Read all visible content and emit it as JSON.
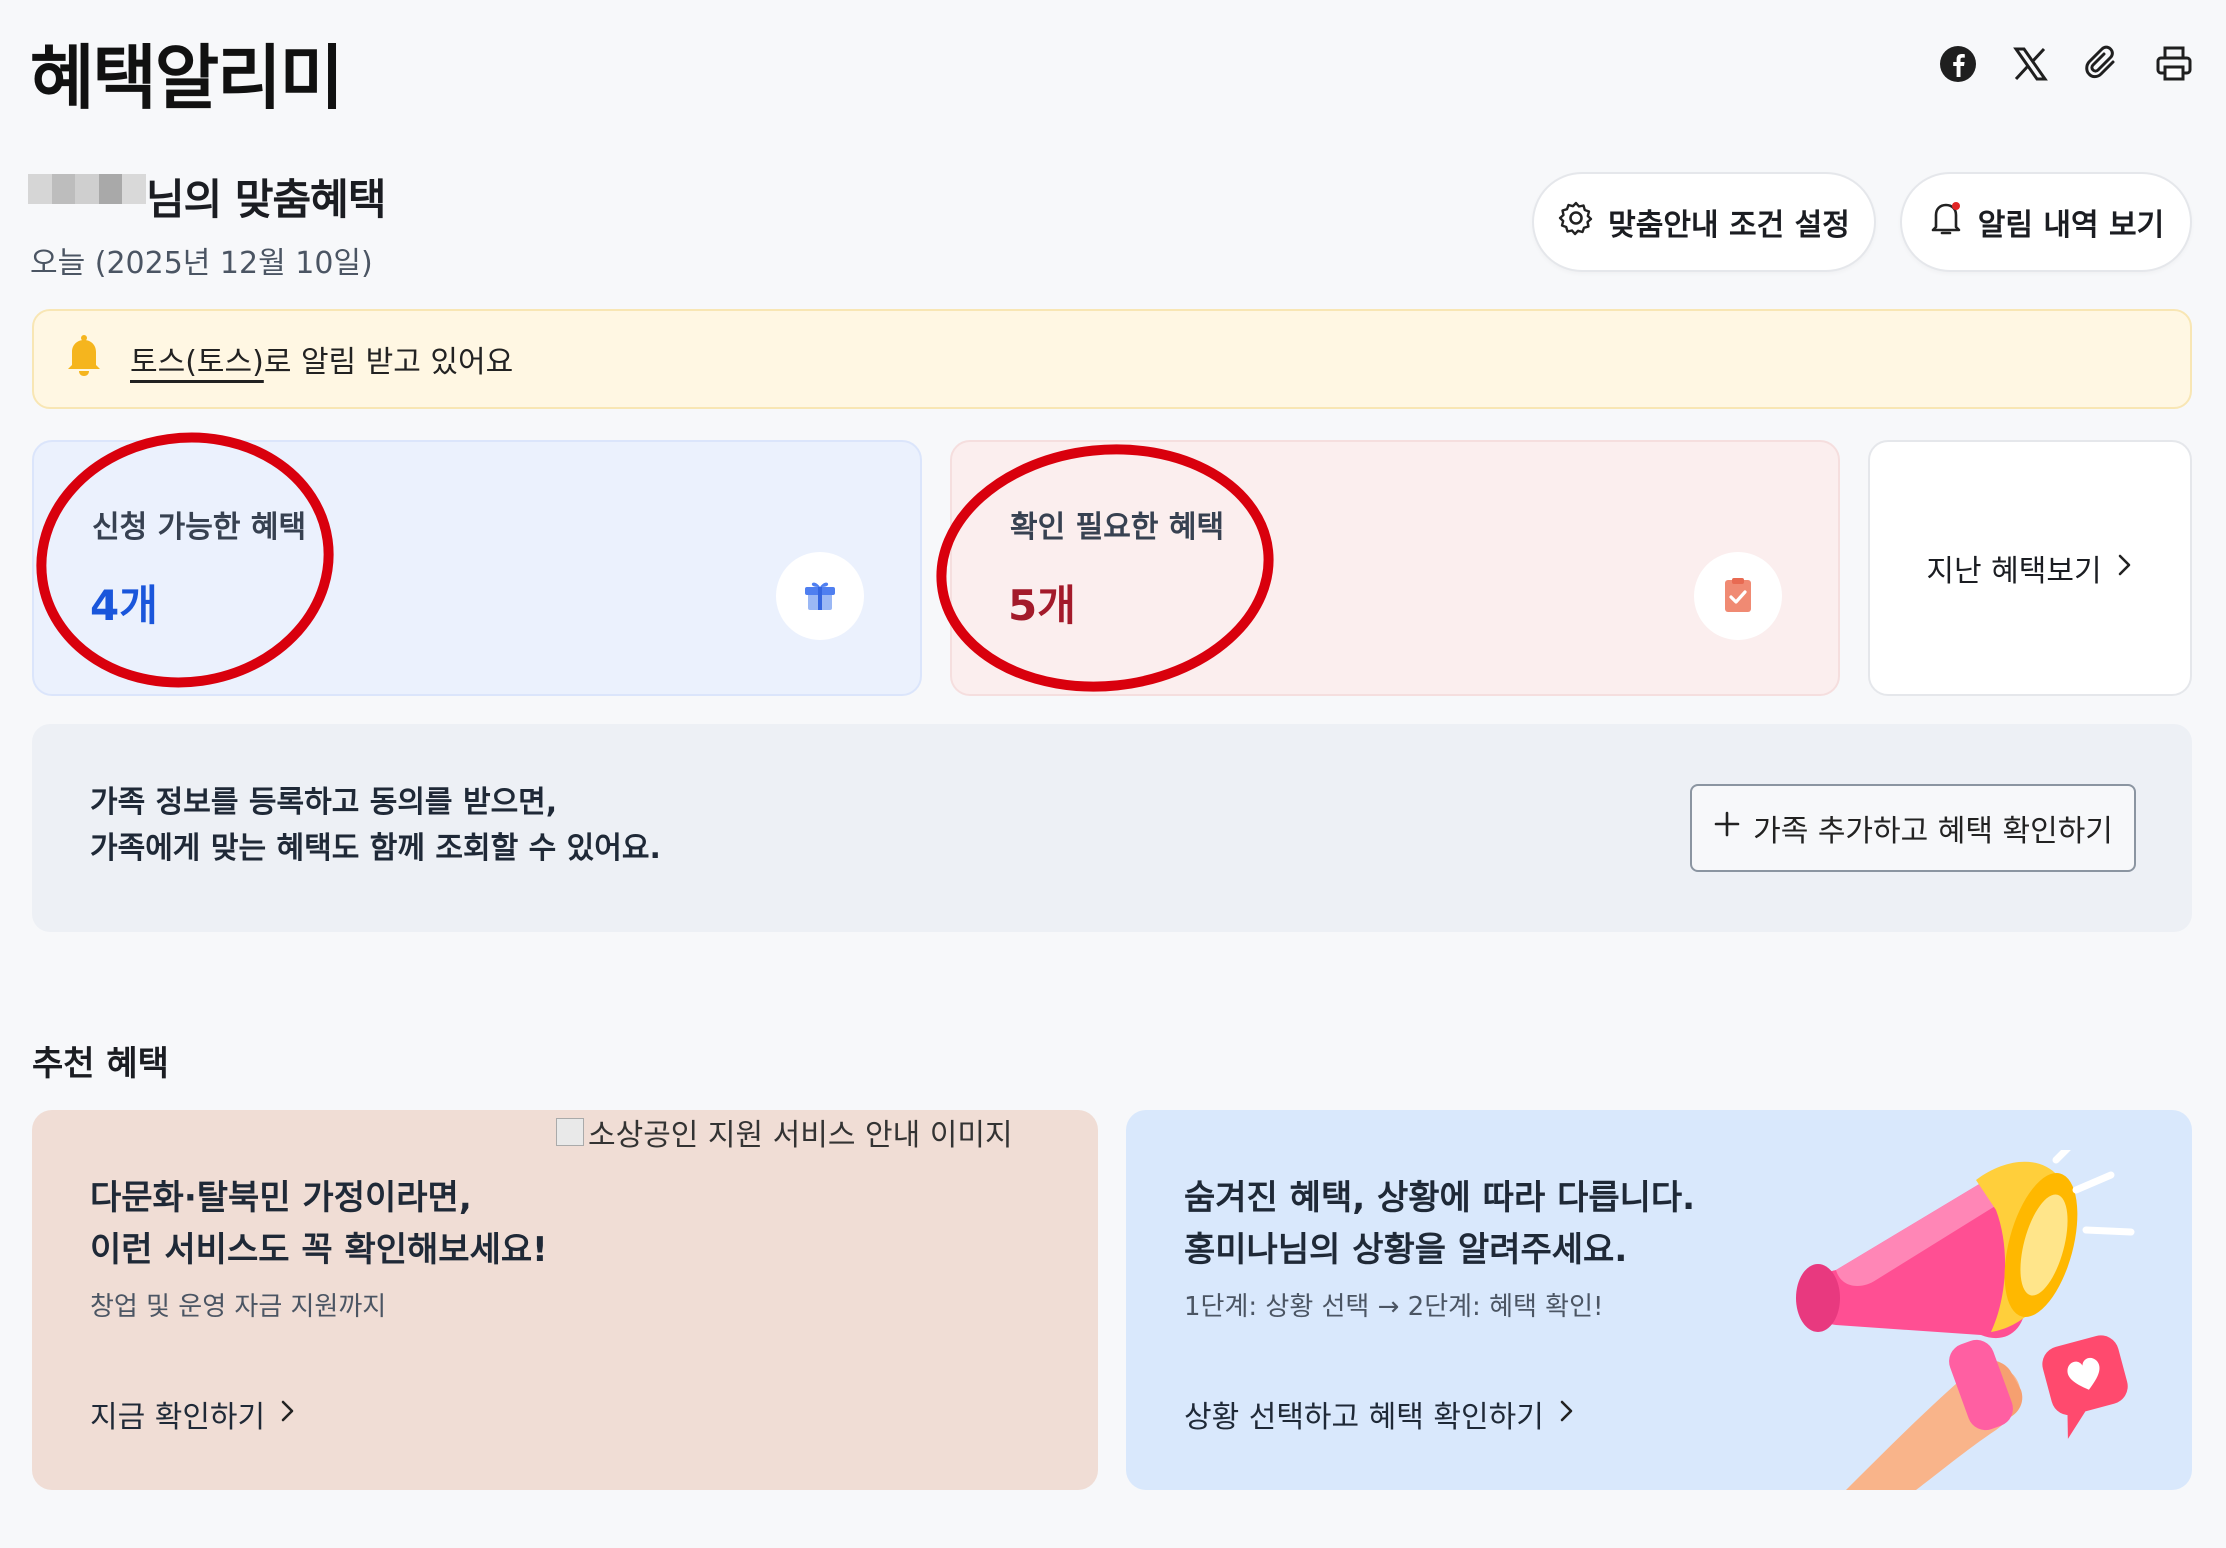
{
  "header": {
    "title": "혜택알리미"
  },
  "share": {
    "icons": [
      "facebook-icon",
      "x-icon",
      "paperclip-icon",
      "printer-icon"
    ]
  },
  "user": {
    "heading": "님의 맞춤혜택",
    "date": "오늘 (2025년 12월 10일)"
  },
  "actions": {
    "settings_label": "맞춤안내 조건 설정",
    "alerts_label": "알림 내역 보기"
  },
  "notice": {
    "link_text": "토스(토스)",
    "text": "로 알림 받고 있어요"
  },
  "stats": {
    "available": {
      "label": "신청 가능한 혜택",
      "count": "4개"
    },
    "check": {
      "label": "확인 필요한 혜택",
      "count": "5개"
    },
    "past_label": "지난 혜택보기"
  },
  "family": {
    "line1": "가족 정보를 등록하고 동의를 받으면,",
    "line2": "가족에게 맞는 혜택도 함께 조회할 수 있어요.",
    "button_label": "가족 추가하고 혜택 확인하기"
  },
  "recommend": {
    "section_title": "추천 혜택",
    "card1": {
      "img_alt": "소상공인 지원 서비스 안내 이미지",
      "title1": "다문화·탈북민 가정이라면,",
      "title2": "이런 서비스도 꼭 확인해보세요!",
      "sub": "창업 및 운영 자금 지원까지",
      "link": "지금 확인하기"
    },
    "card2": {
      "title1": "숨겨진 혜택, 상황에 따라 다릅니다.",
      "title2": "홍미나님의 상황을 알려주세요.",
      "sub": "1단계: 상황 선택 → 2단계: 혜택 확인!",
      "link": "상황 선택하고 혜택 확인하기"
    }
  },
  "colors": {
    "accent_blue": "#1a56db",
    "accent_red": "#a31a2a",
    "annotation": "#d9000d"
  }
}
